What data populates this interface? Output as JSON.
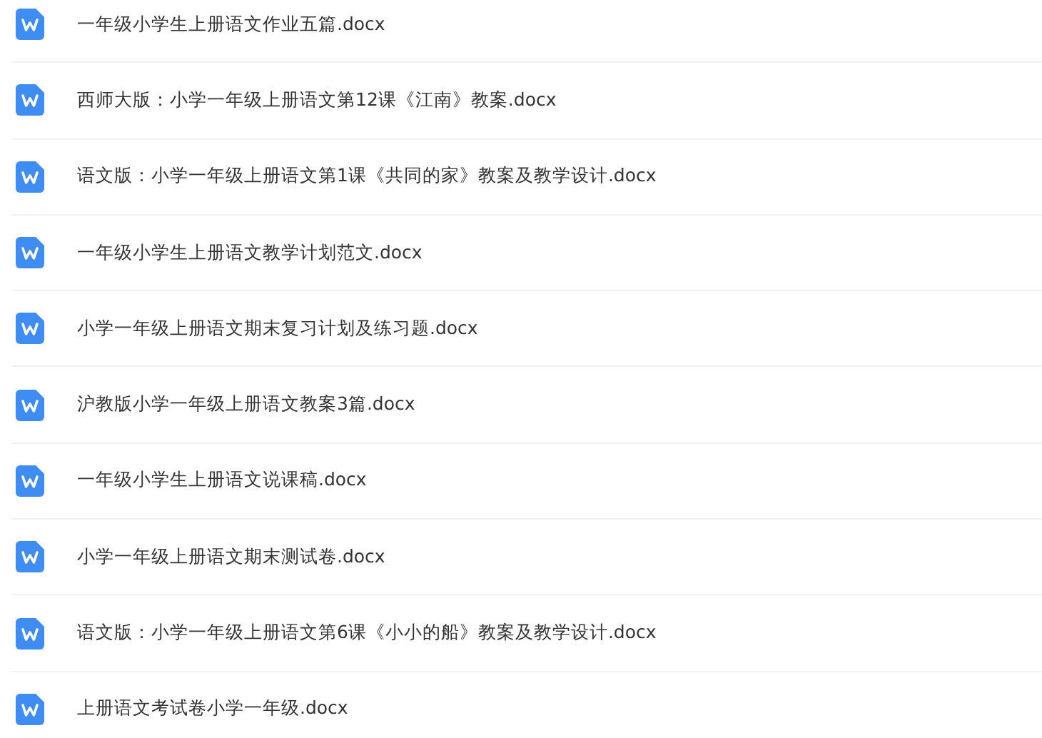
{
  "files": [
    {
      "name": "一年级小学生上册语文作业五篇.docx"
    },
    {
      "name": "西师大版：小学一年级上册语文第12课《江南》教案.docx"
    },
    {
      "name": "语文版：小学一年级上册语文第1课《共同的家》教案及教学设计.docx"
    },
    {
      "name": "一年级小学生上册语文教学计划范文.docx"
    },
    {
      "name": "小学一年级上册语文期末复习计划及练习题.docx"
    },
    {
      "name": "沪教版小学一年级上册语文教案3篇.docx"
    },
    {
      "name": "一年级小学生上册语文说课稿.docx"
    },
    {
      "name": "小学一年级上册语文期末测试卷.docx"
    },
    {
      "name": "语文版：小学一年级上册语文第6课《小小的船》教案及教学设计.docx"
    },
    {
      "name": "上册语文考试卷小学一年级.docx"
    }
  ]
}
